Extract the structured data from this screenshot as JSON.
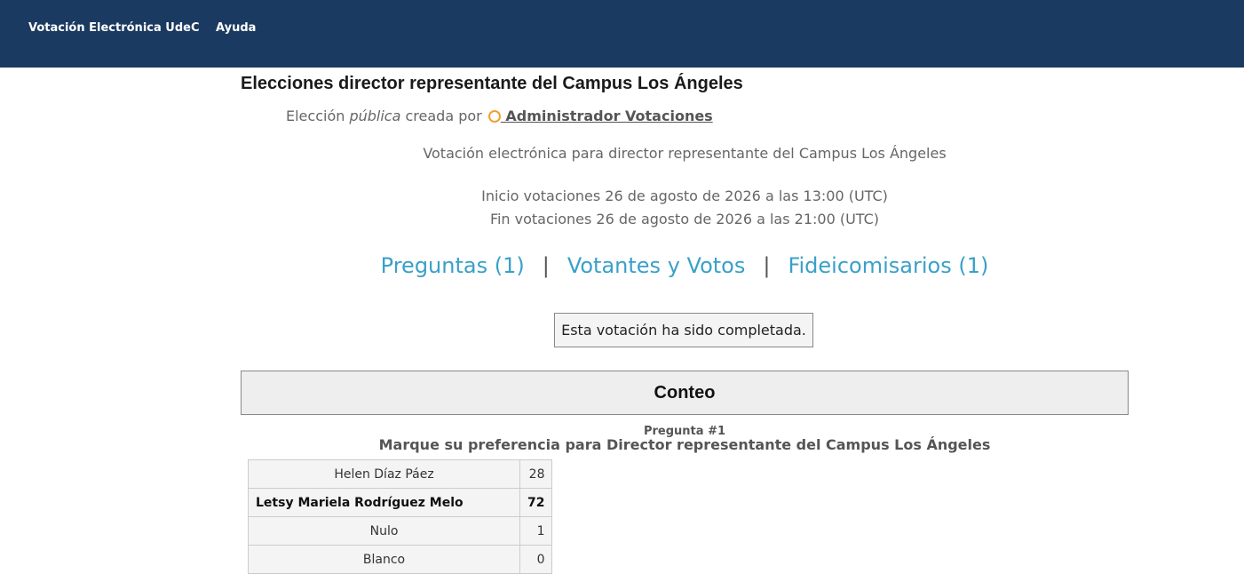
{
  "nav": {
    "home": "Votación Electrónica UdeC",
    "help": "Ayuda"
  },
  "election": {
    "title": "Elecciones director representante del Campus Los Ángeles",
    "created_prefix": "Elección ",
    "visibility": "pública",
    "created_mid": " creada por ",
    "creator": " Administrador Votaciones",
    "description": "Votación electrónica para director representante del Campus Los Ángeles",
    "start": "Inicio votaciones 26 de agosto de 2026 a las 13:00 (UTC)",
    "end": "Fin votaciones 26 de agosto de 2026 a las 21:00 (UTC)"
  },
  "links": {
    "questions": "Preguntas (1)",
    "voters": "Votantes y Votos",
    "trustees": "Fideicomisarios (1)",
    "separator": "|"
  },
  "status": "Esta votación ha sido completada.",
  "tally": {
    "heading": "Conteo",
    "question_number": "Pregunta #1",
    "question_text": "Marque su preferencia para Director representante del Campus Los Ángeles",
    "rows": [
      {
        "name": "Helen Díaz Páez",
        "votes": "28"
      },
      {
        "name": "Letsy Mariela Rodríguez Melo",
        "votes": "72"
      },
      {
        "name": "Nulo",
        "votes": "1"
      },
      {
        "name": "Blanco",
        "votes": "0"
      }
    ]
  },
  "colors": {
    "header_bg": "#1b3a61",
    "link": "#3aa0c8",
    "user_icon": "#f0a030"
  }
}
